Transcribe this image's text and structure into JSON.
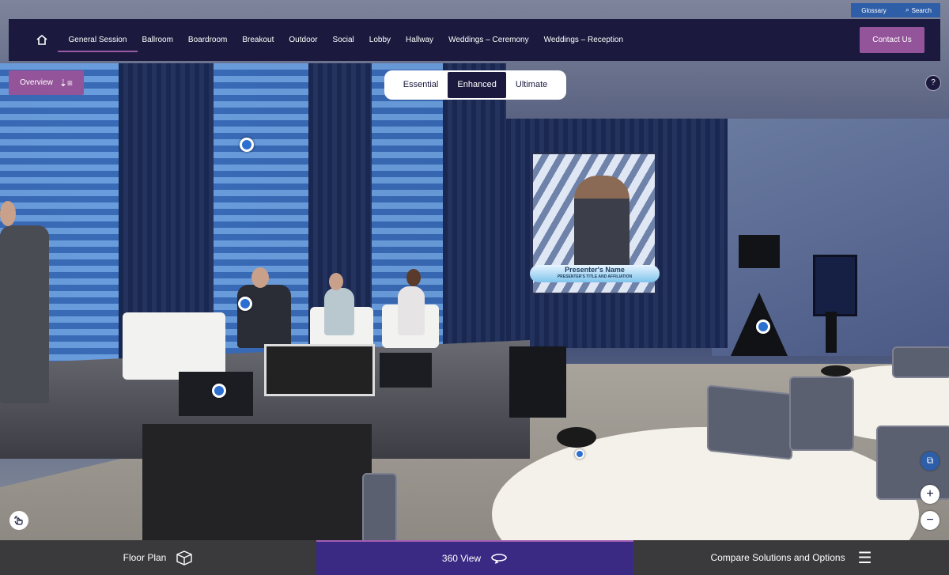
{
  "nav": {
    "tabs": [
      {
        "label": "General Session",
        "active": true
      },
      {
        "label": "Ballroom"
      },
      {
        "label": "Boardroom"
      },
      {
        "label": "Breakout"
      },
      {
        "label": "Outdoor"
      },
      {
        "label": "Social"
      },
      {
        "label": "Lobby"
      },
      {
        "label": "Hallway"
      },
      {
        "label": "Weddings – Ceremony"
      },
      {
        "label": "Weddings – Reception"
      }
    ],
    "contact_label": "Contact Us",
    "glossary_label": "Glossary",
    "search_label": "Search",
    "home_icon": "home-icon"
  },
  "overview_label": "Overview",
  "tiers": [
    {
      "label": "Essential"
    },
    {
      "label": "Enhanced",
      "active": true
    },
    {
      "label": "Ultimate"
    }
  ],
  "scene": {
    "screen_name": "Presenter's Name",
    "screen_title": "PRESENTER'S TITLE AND AFFILIATION"
  },
  "controls": {
    "help": "?",
    "zoom_in": "+",
    "zoom_out": "−"
  },
  "bottom": {
    "floor_plan": "Floor Plan",
    "view_360": "360 View",
    "compare": "Compare Solutions and Options"
  },
  "colors": {
    "nav_bg": "#1b1a3e",
    "accent_purple": "#94549a",
    "utility_blue": "#2e5ea8",
    "active_bottom": "#3a2a84"
  }
}
